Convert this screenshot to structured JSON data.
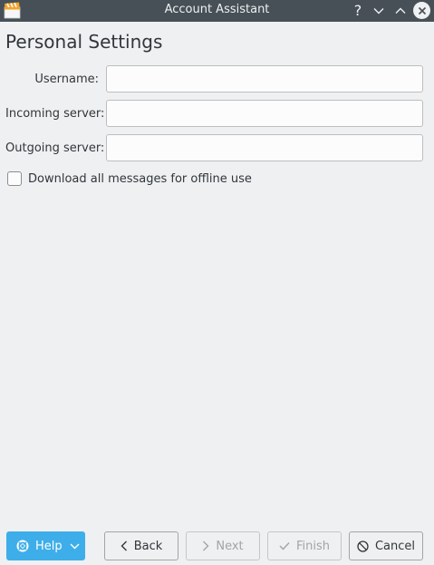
{
  "window": {
    "title": "Account Assistant",
    "help_glyph": "?"
  },
  "page": {
    "title": "Personal Settings"
  },
  "form": {
    "username": {
      "label": "Username:",
      "value": ""
    },
    "incoming_server": {
      "label": "Incoming server:",
      "value": ""
    },
    "outgoing_server": {
      "label": "Outgoing server:",
      "value": ""
    },
    "offline_checkbox": {
      "label": "Download all messages for offline use",
      "checked": false
    }
  },
  "buttons": {
    "help": "Help",
    "back": "Back",
    "next": "Next",
    "finish": "Finish",
    "cancel": "Cancel"
  },
  "icons": {
    "app": "clapperboard-icon",
    "help_button": "lifebuoy-icon",
    "back": "chevron-left-icon",
    "next": "chevron-right-icon",
    "finish": "checkmark-icon",
    "cancel": "cancel-icon"
  },
  "colors": {
    "titlebar": "#475057",
    "background": "#eff0f1",
    "accent": "#3daee9",
    "text": "#31363b",
    "disabled_text": "#a1a4a7"
  }
}
